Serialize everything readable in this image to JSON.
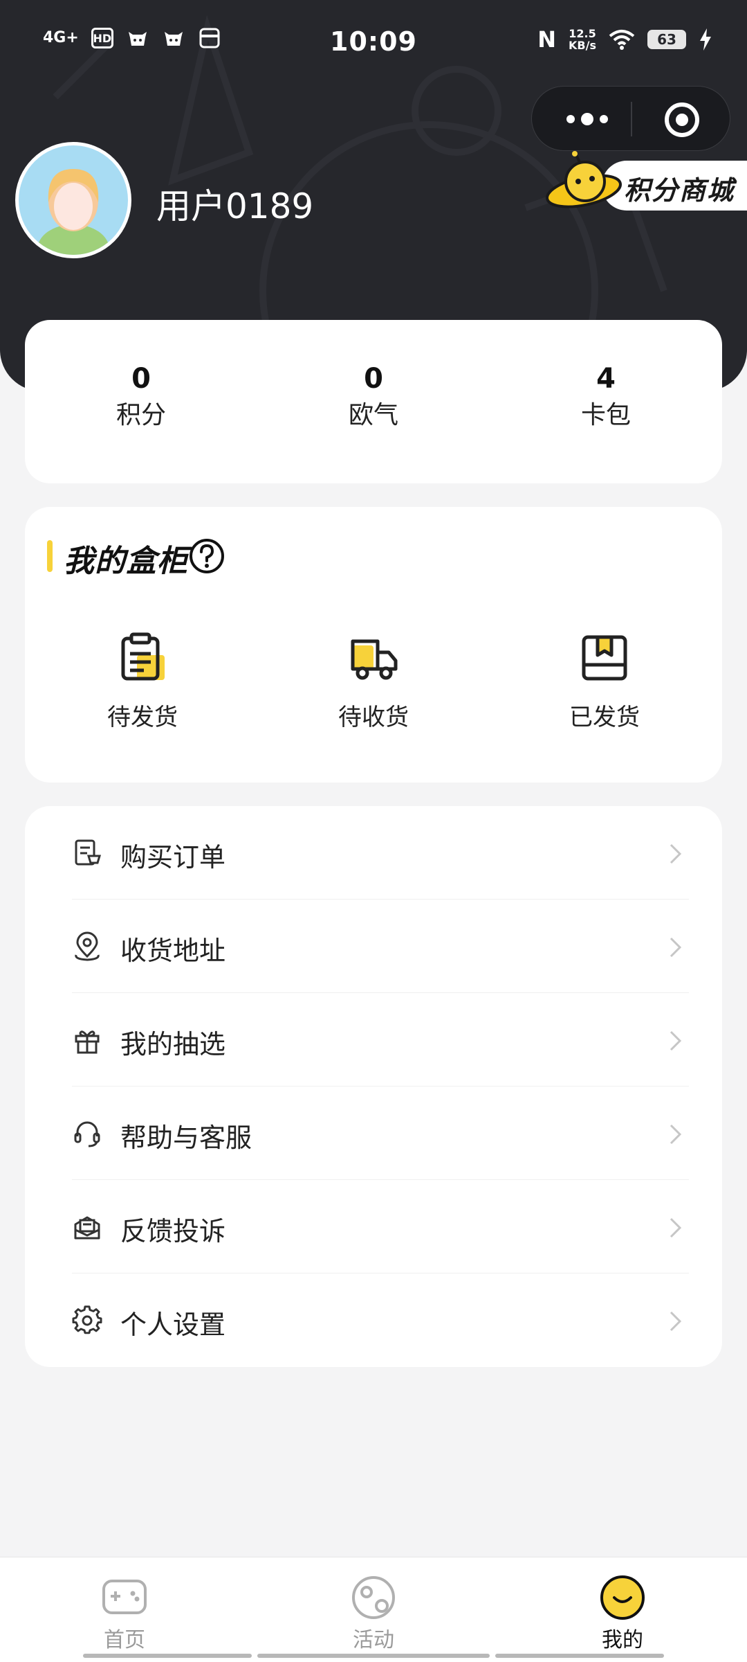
{
  "status_bar": {
    "network": "4G+",
    "hd_badge": "HD",
    "time": "10:09",
    "nfc": "N",
    "speed_value": "12.5",
    "speed_unit": "KB/s",
    "battery": "63"
  },
  "header": {
    "username": "用户0189",
    "mall_label": "积分商城"
  },
  "stats": [
    {
      "value": "0",
      "label": "积分"
    },
    {
      "value": "0",
      "label": "欧气"
    },
    {
      "value": "4",
      "label": "卡包"
    }
  ],
  "cabinet": {
    "title": "我的盒柜",
    "items": [
      {
        "label": "待发货",
        "icon": "clipboard-icon"
      },
      {
        "label": "待收货",
        "icon": "truck-icon"
      },
      {
        "label": "已发货",
        "icon": "package-icon"
      }
    ]
  },
  "menu": [
    {
      "label": "购买订单",
      "icon": "order-icon"
    },
    {
      "label": "收货地址",
      "icon": "location-icon"
    },
    {
      "label": "我的抽选",
      "icon": "gift-icon"
    },
    {
      "label": "帮助与客服",
      "icon": "headset-icon"
    },
    {
      "label": "反馈投诉",
      "icon": "feedback-icon"
    },
    {
      "label": "个人设置",
      "icon": "gear-icon"
    }
  ],
  "tabs": [
    {
      "label": "首页",
      "icon": "gamepad-icon",
      "active": false
    },
    {
      "label": "活动",
      "icon": "activity-icon",
      "active": false
    },
    {
      "label": "我的",
      "icon": "smile-icon",
      "active": true
    }
  ],
  "colors": {
    "header_bg": "#26272c",
    "accent_yellow": "#f7d23a",
    "page_bg": "#f4f4f5"
  }
}
